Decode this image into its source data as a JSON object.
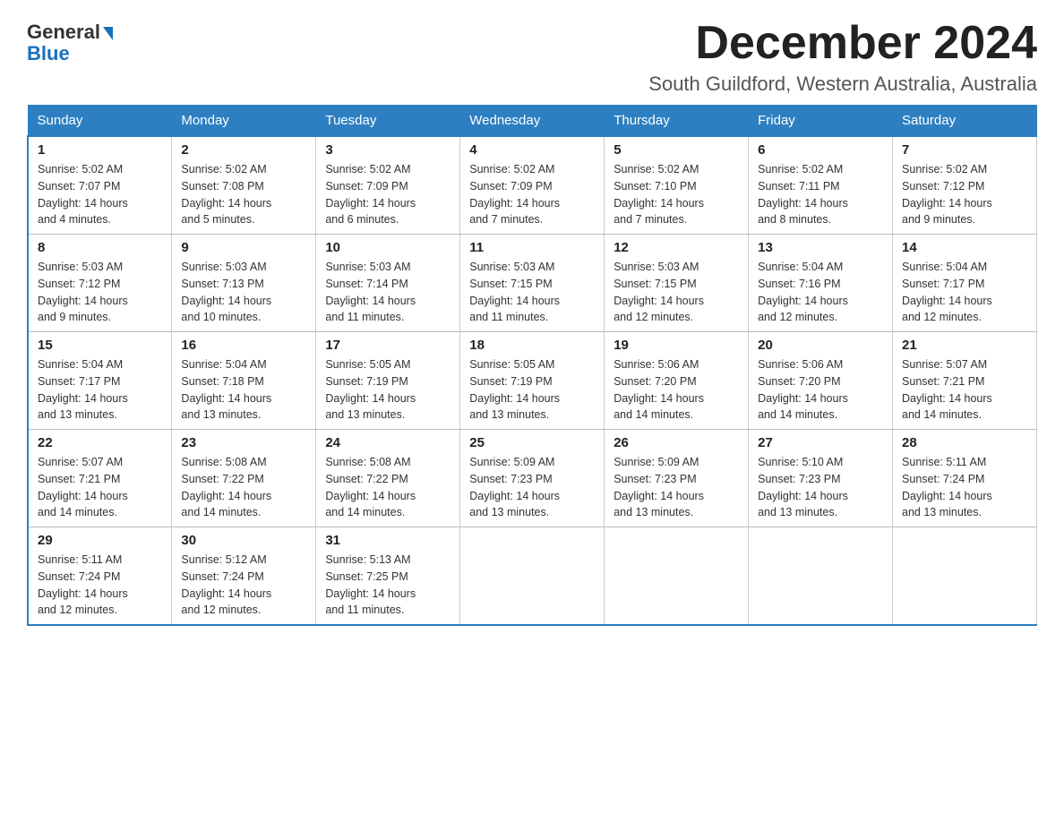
{
  "header": {
    "logo_line1": "General",
    "logo_line2": "Blue",
    "month_title": "December 2024",
    "location": "South Guildford, Western Australia, Australia"
  },
  "days_of_week": [
    "Sunday",
    "Monday",
    "Tuesday",
    "Wednesday",
    "Thursday",
    "Friday",
    "Saturday"
  ],
  "weeks": [
    [
      {
        "day": "1",
        "sunrise": "5:02 AM",
        "sunset": "7:07 PM",
        "daylight": "14 hours and 4 minutes."
      },
      {
        "day": "2",
        "sunrise": "5:02 AM",
        "sunset": "7:08 PM",
        "daylight": "14 hours and 5 minutes."
      },
      {
        "day": "3",
        "sunrise": "5:02 AM",
        "sunset": "7:09 PM",
        "daylight": "14 hours and 6 minutes."
      },
      {
        "day": "4",
        "sunrise": "5:02 AM",
        "sunset": "7:09 PM",
        "daylight": "14 hours and 7 minutes."
      },
      {
        "day": "5",
        "sunrise": "5:02 AM",
        "sunset": "7:10 PM",
        "daylight": "14 hours and 7 minutes."
      },
      {
        "day": "6",
        "sunrise": "5:02 AM",
        "sunset": "7:11 PM",
        "daylight": "14 hours and 8 minutes."
      },
      {
        "day": "7",
        "sunrise": "5:02 AM",
        "sunset": "7:12 PM",
        "daylight": "14 hours and 9 minutes."
      }
    ],
    [
      {
        "day": "8",
        "sunrise": "5:03 AM",
        "sunset": "7:12 PM",
        "daylight": "14 hours and 9 minutes."
      },
      {
        "day": "9",
        "sunrise": "5:03 AM",
        "sunset": "7:13 PM",
        "daylight": "14 hours and 10 minutes."
      },
      {
        "day": "10",
        "sunrise": "5:03 AM",
        "sunset": "7:14 PM",
        "daylight": "14 hours and 11 minutes."
      },
      {
        "day": "11",
        "sunrise": "5:03 AM",
        "sunset": "7:15 PM",
        "daylight": "14 hours and 11 minutes."
      },
      {
        "day": "12",
        "sunrise": "5:03 AM",
        "sunset": "7:15 PM",
        "daylight": "14 hours and 12 minutes."
      },
      {
        "day": "13",
        "sunrise": "5:04 AM",
        "sunset": "7:16 PM",
        "daylight": "14 hours and 12 minutes."
      },
      {
        "day": "14",
        "sunrise": "5:04 AM",
        "sunset": "7:17 PM",
        "daylight": "14 hours and 12 minutes."
      }
    ],
    [
      {
        "day": "15",
        "sunrise": "5:04 AM",
        "sunset": "7:17 PM",
        "daylight": "14 hours and 13 minutes."
      },
      {
        "day": "16",
        "sunrise": "5:04 AM",
        "sunset": "7:18 PM",
        "daylight": "14 hours and 13 minutes."
      },
      {
        "day": "17",
        "sunrise": "5:05 AM",
        "sunset": "7:19 PM",
        "daylight": "14 hours and 13 minutes."
      },
      {
        "day": "18",
        "sunrise": "5:05 AM",
        "sunset": "7:19 PM",
        "daylight": "14 hours and 13 minutes."
      },
      {
        "day": "19",
        "sunrise": "5:06 AM",
        "sunset": "7:20 PM",
        "daylight": "14 hours and 14 minutes."
      },
      {
        "day": "20",
        "sunrise": "5:06 AM",
        "sunset": "7:20 PM",
        "daylight": "14 hours and 14 minutes."
      },
      {
        "day": "21",
        "sunrise": "5:07 AM",
        "sunset": "7:21 PM",
        "daylight": "14 hours and 14 minutes."
      }
    ],
    [
      {
        "day": "22",
        "sunrise": "5:07 AM",
        "sunset": "7:21 PM",
        "daylight": "14 hours and 14 minutes."
      },
      {
        "day": "23",
        "sunrise": "5:08 AM",
        "sunset": "7:22 PM",
        "daylight": "14 hours and 14 minutes."
      },
      {
        "day": "24",
        "sunrise": "5:08 AM",
        "sunset": "7:22 PM",
        "daylight": "14 hours and 14 minutes."
      },
      {
        "day": "25",
        "sunrise": "5:09 AM",
        "sunset": "7:23 PM",
        "daylight": "14 hours and 13 minutes."
      },
      {
        "day": "26",
        "sunrise": "5:09 AM",
        "sunset": "7:23 PM",
        "daylight": "14 hours and 13 minutes."
      },
      {
        "day": "27",
        "sunrise": "5:10 AM",
        "sunset": "7:23 PM",
        "daylight": "14 hours and 13 minutes."
      },
      {
        "day": "28",
        "sunrise": "5:11 AM",
        "sunset": "7:24 PM",
        "daylight": "14 hours and 13 minutes."
      }
    ],
    [
      {
        "day": "29",
        "sunrise": "5:11 AM",
        "sunset": "7:24 PM",
        "daylight": "14 hours and 12 minutes."
      },
      {
        "day": "30",
        "sunrise": "5:12 AM",
        "sunset": "7:24 PM",
        "daylight": "14 hours and 12 minutes."
      },
      {
        "day": "31",
        "sunrise": "5:13 AM",
        "sunset": "7:25 PM",
        "daylight": "14 hours and 11 minutes."
      },
      null,
      null,
      null,
      null
    ]
  ],
  "labels": {
    "sunrise": "Sunrise:",
    "sunset": "Sunset:",
    "daylight": "Daylight:"
  }
}
